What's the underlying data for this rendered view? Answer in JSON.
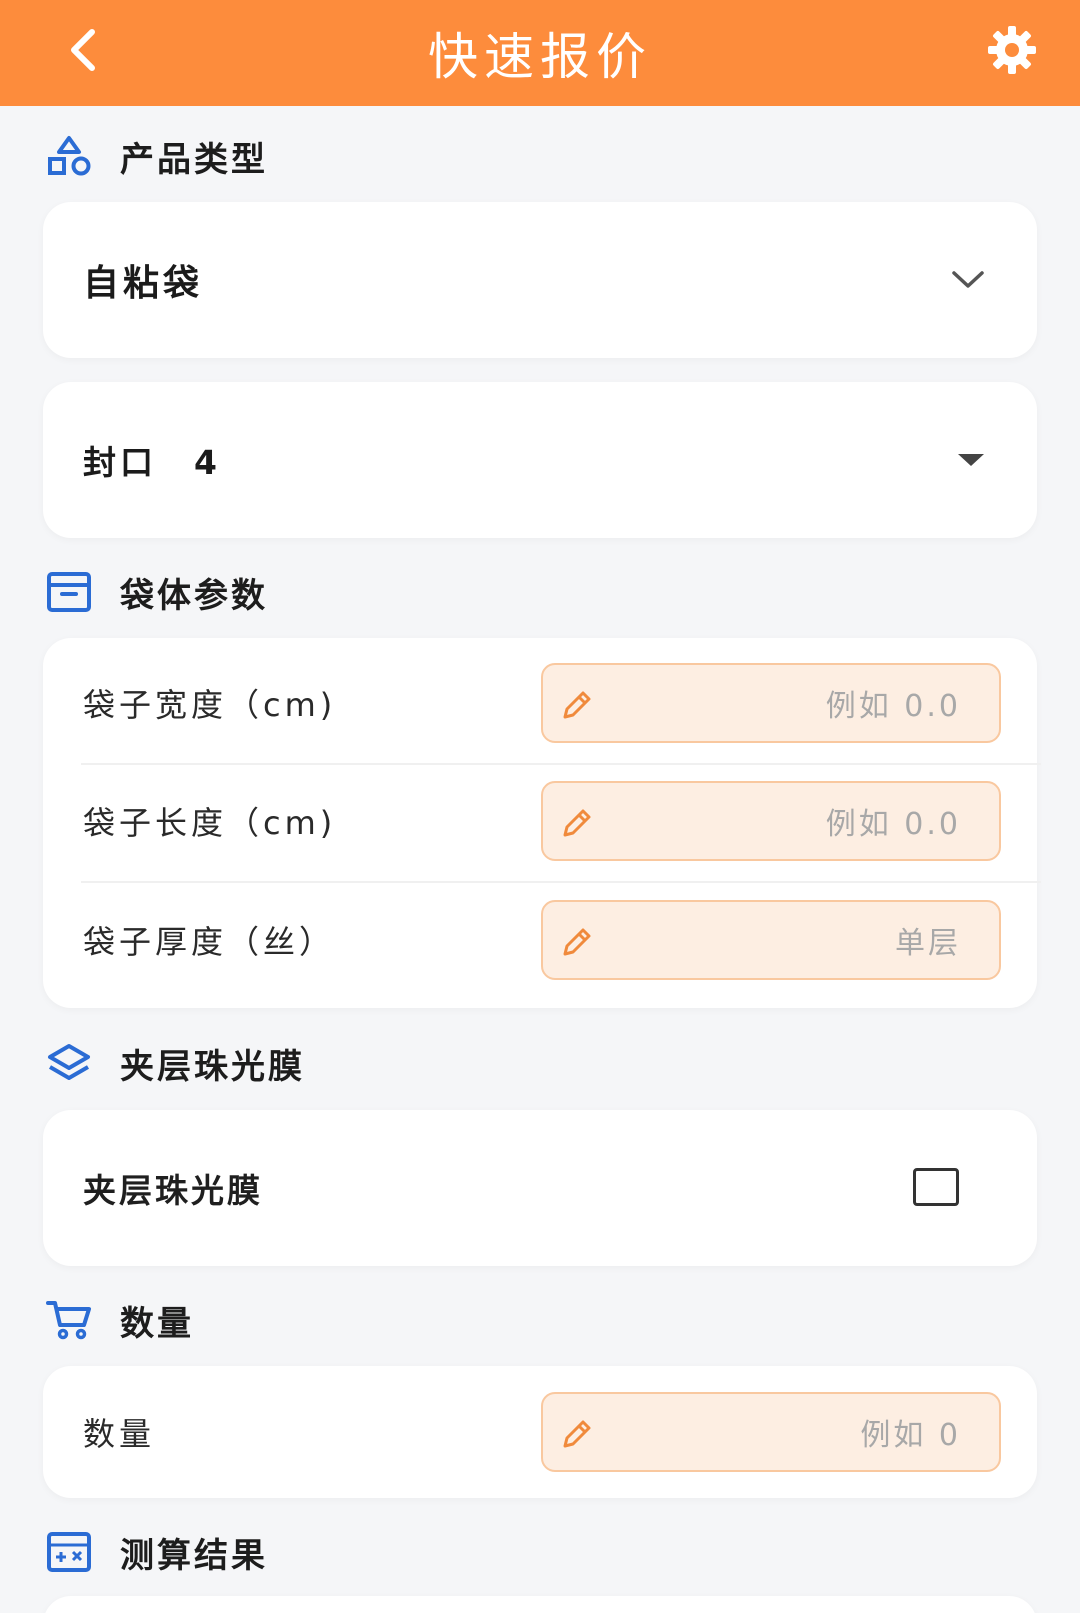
{
  "header": {
    "title": "快速报价",
    "back_icon": "chevron-left-icon",
    "settings_icon": "gear-icon"
  },
  "colors": {
    "accent": "#fd8c3c",
    "icon_blue": "#2b6cd4",
    "input_bg": "#fdeee2",
    "input_border": "#f9c89f",
    "pencil": "#f08a3c"
  },
  "product_type": {
    "heading": "产品类型",
    "selected_product": "自粘袋",
    "seal_selected": "封口　4"
  },
  "bag_params": {
    "heading": "袋体参数",
    "fields": [
      {
        "label": "袋子宽度（cm)",
        "placeholder": "例如 0.0"
      },
      {
        "label": "袋子长度（cm)",
        "placeholder": "例如 0.0"
      },
      {
        "label": "袋子厚度（丝）",
        "placeholder": "单层"
      }
    ]
  },
  "pearl_film": {
    "heading": "夹层珠光膜",
    "label": "夹层珠光膜",
    "checked": false
  },
  "quantity": {
    "heading": "数量",
    "label": "数量",
    "placeholder": "例如 0"
  },
  "result": {
    "heading": "测算结果"
  }
}
